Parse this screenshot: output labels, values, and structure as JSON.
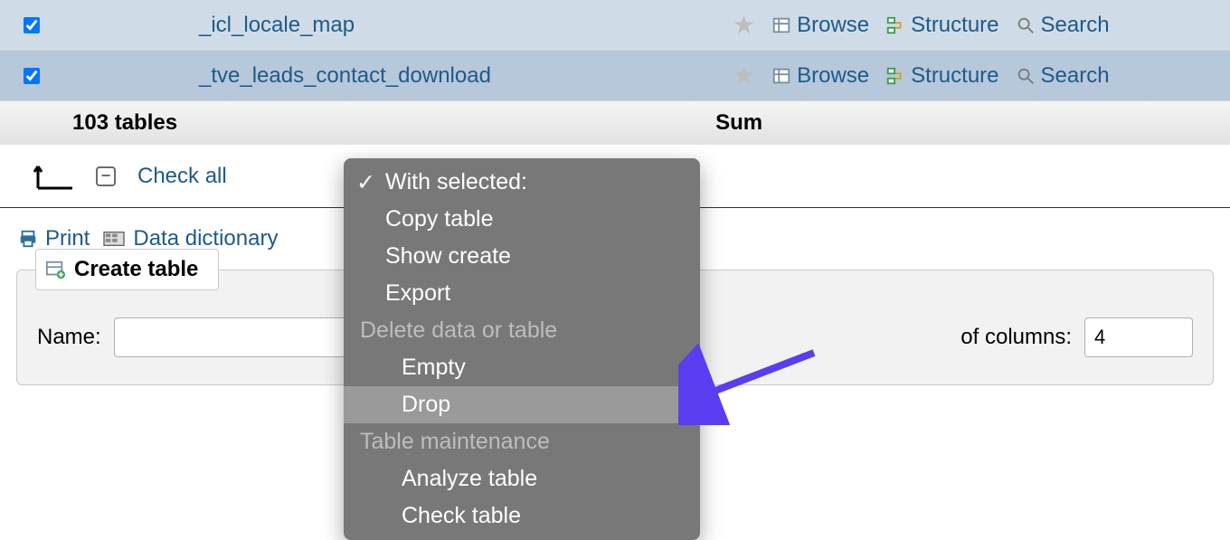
{
  "tables": [
    {
      "name": "_icl_locale_map",
      "checked": true
    },
    {
      "name": "_tve_leads_contact_download",
      "checked": true
    }
  ],
  "actions": {
    "browse": "Browse",
    "structure": "Structure",
    "search": "Search"
  },
  "summary": {
    "count_label": "103 tables",
    "sum_label": "Sum"
  },
  "checkall_label": "Check all",
  "tools": {
    "print": "Print",
    "data_dictionary": "Data dictionary"
  },
  "create_table": {
    "button": "Create table",
    "name_label": "Name:",
    "name_value": "",
    "cols_label": "of columns:",
    "cols_value": "4"
  },
  "dropdown": {
    "items": [
      {
        "label": "With selected:",
        "type": "item",
        "selected": true
      },
      {
        "label": "Copy table",
        "type": "item"
      },
      {
        "label": "Show create",
        "type": "item"
      },
      {
        "label": "Export",
        "type": "item"
      },
      {
        "label": "Delete data or table",
        "type": "group"
      },
      {
        "label": "Empty",
        "type": "item",
        "indent": true
      },
      {
        "label": "Drop",
        "type": "item",
        "indent": true,
        "hover": true
      },
      {
        "label": "Table maintenance",
        "type": "group"
      },
      {
        "label": "Analyze table",
        "type": "item",
        "indent": true
      },
      {
        "label": "Check table",
        "type": "item",
        "indent": true
      }
    ]
  },
  "colors": {
    "link": "#1d5a8a",
    "menu_bg": "#787878",
    "arrow": "#5a3df0"
  }
}
